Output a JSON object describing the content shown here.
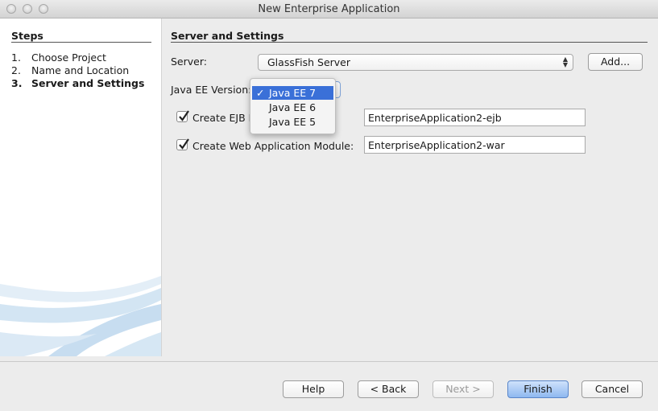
{
  "window": {
    "title": "New Enterprise Application"
  },
  "steps": {
    "title": "Steps",
    "items": [
      {
        "num": "1.",
        "label": "Choose Project"
      },
      {
        "num": "2.",
        "label": "Name and Location"
      },
      {
        "num": "3.",
        "label": "Server and Settings"
      }
    ]
  },
  "panel": {
    "title": "Server and Settings",
    "server_label": "Server:",
    "server_value": "GlassFish Server",
    "add_label": "Add...",
    "javaee_label": "Java EE Version:",
    "javaee_options": [
      "Java EE 7",
      "Java EE 6",
      "Java EE 5"
    ],
    "javaee_selected": "Java EE 7",
    "check_mark": "✓",
    "ejb_label": "Create EJB M",
    "ejb_checked": true,
    "ejb_value": "EnterpriseApplication2-ejb",
    "war_label": "Create Web Application Module:",
    "war_checked": true,
    "war_value": "EnterpriseApplication2-war"
  },
  "buttons": {
    "help": "Help",
    "back": "< Back",
    "next": "Next >",
    "finish": "Finish",
    "cancel": "Cancel"
  },
  "colors": {
    "accent": "#3a70d8",
    "default_button": "#8eb8f0"
  }
}
